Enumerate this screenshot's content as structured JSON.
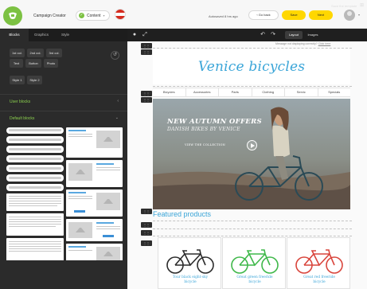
{
  "topbar": {
    "app_title": "Campaign Creator",
    "content_label": "Content",
    "autosave": "Autosaved 8 hrs ago",
    "back_label": "Go back",
    "save_label": "Save",
    "next_label": "Next",
    "accent": "#7cc142",
    "button_color": "#ffd700"
  },
  "sidebar": {
    "tabs": [
      "Blocks",
      "Graphics",
      "Style"
    ],
    "chips_row1": [
      "1st col.",
      "2nd col.",
      "3rd col."
    ],
    "chips_row2": [
      "Text",
      "Button",
      "Photo"
    ],
    "chips_row3": [
      "Style 1",
      "Style 2"
    ],
    "sections": {
      "user_blocks": "User blocks",
      "default_blocks": "Default blocks"
    },
    "thumb_heading": "Lorem Ipsum"
  },
  "canvas": {
    "toolbar": {
      "layout_label": "Layout",
      "images_label": "Images",
      "save_template": "Save the template"
    },
    "email_notice": "Message not displaying correctly?",
    "email_notice_link": "Click here",
    "brand_title": "Venice bicycles",
    "nav": [
      "Bicycles",
      "Accessories",
      "Parts",
      "Clothing",
      "Servic",
      "Specials"
    ],
    "hero": {
      "headline": "NEW AUTUMN OFFERS",
      "subhead": "DANISH BIKES BY VENICE",
      "cta": "VIEW THE COLLECTION"
    },
    "featured_title": "Featured products",
    "products": [
      {
        "name_line1": "Tour black eight-sky",
        "name_line2": "bicycle",
        "color": "#2b2b2b"
      },
      {
        "name_line1": "Great green freeride",
        "name_line2": "bicycle",
        "color": "#3fb84a"
      },
      {
        "name_line1": "Great red freeride",
        "name_line2": "bicycle",
        "color": "#d9453c"
      }
    ]
  }
}
